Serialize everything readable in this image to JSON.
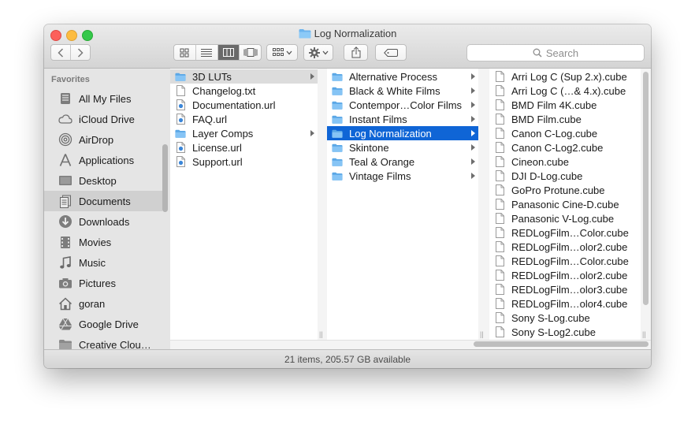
{
  "window": {
    "title": "Log Normalization"
  },
  "toolbar": {
    "search_placeholder": "Search"
  },
  "sidebar": {
    "heading": "Favorites",
    "items": [
      {
        "label": "All My Files",
        "icon": "all-files-icon"
      },
      {
        "label": "iCloud Drive",
        "icon": "cloud-icon"
      },
      {
        "label": "AirDrop",
        "icon": "airdrop-icon"
      },
      {
        "label": "Applications",
        "icon": "applications-icon"
      },
      {
        "label": "Desktop",
        "icon": "desktop-icon"
      },
      {
        "label": "Documents",
        "icon": "documents-icon",
        "selected": true
      },
      {
        "label": "Downloads",
        "icon": "downloads-icon"
      },
      {
        "label": "Movies",
        "icon": "movies-icon"
      },
      {
        "label": "Music",
        "icon": "music-icon"
      },
      {
        "label": "Pictures",
        "icon": "pictures-icon"
      },
      {
        "label": "goran",
        "icon": "home-icon"
      },
      {
        "label": "Google Drive",
        "icon": "google-drive-icon"
      },
      {
        "label": "Creative Clou…",
        "icon": "folder-icon"
      }
    ]
  },
  "columns": {
    "col1": [
      {
        "label": "3D LUTs",
        "type": "folder",
        "arrow": true,
        "state": "path"
      },
      {
        "label": "Changelog.txt",
        "type": "file"
      },
      {
        "label": "Documentation.url",
        "type": "url"
      },
      {
        "label": "FAQ.url",
        "type": "url"
      },
      {
        "label": "Layer Comps",
        "type": "folder",
        "arrow": true
      },
      {
        "label": "License.url",
        "type": "url"
      },
      {
        "label": "Support.url",
        "type": "url"
      }
    ],
    "col2": [
      {
        "label": "Alternative Process",
        "type": "folder",
        "arrow": true
      },
      {
        "label": "Black & White Films",
        "type": "folder",
        "arrow": true
      },
      {
        "label": "Contempor…Color Films",
        "type": "folder",
        "arrow": true
      },
      {
        "label": "Instant Films",
        "type": "folder",
        "arrow": true
      },
      {
        "label": "Log Normalization",
        "type": "folder",
        "arrow": true,
        "state": "selected"
      },
      {
        "label": "Skintone",
        "type": "folder",
        "arrow": true
      },
      {
        "label": "Teal & Orange",
        "type": "folder",
        "arrow": true
      },
      {
        "label": "Vintage Films",
        "type": "folder",
        "arrow": true
      }
    ],
    "col3": [
      {
        "label": "Arri Log C (Sup 2.x).cube",
        "type": "file"
      },
      {
        "label": "Arri Log C (…& 4.x).cube",
        "type": "file"
      },
      {
        "label": "BMD Film 4K.cube",
        "type": "file"
      },
      {
        "label": "BMD Film.cube",
        "type": "file"
      },
      {
        "label": "Canon C-Log.cube",
        "type": "file"
      },
      {
        "label": "Canon C-Log2.cube",
        "type": "file"
      },
      {
        "label": "Cineon.cube",
        "type": "file"
      },
      {
        "label": "DJI D-Log.cube",
        "type": "file"
      },
      {
        "label": "GoPro Protune.cube",
        "type": "file"
      },
      {
        "label": "Panasonic Cine-D.cube",
        "type": "file"
      },
      {
        "label": "Panasonic V-Log.cube",
        "type": "file"
      },
      {
        "label": "REDLogFilm…Color.cube",
        "type": "file"
      },
      {
        "label": "REDLogFilm…olor2.cube",
        "type": "file"
      },
      {
        "label": "REDLogFilm…Color.cube",
        "type": "file"
      },
      {
        "label": "REDLogFilm…olor2.cube",
        "type": "file"
      },
      {
        "label": "REDLogFilm…olor3.cube",
        "type": "file"
      },
      {
        "label": "REDLogFilm…olor4.cube",
        "type": "file"
      },
      {
        "label": "Sony S-Log.cube",
        "type": "file"
      },
      {
        "label": "Sony S-Log2.cube",
        "type": "file"
      }
    ]
  },
  "status": {
    "text": "21 items, 205.57 GB available"
  },
  "colors": {
    "selection": "#0f65d6",
    "folder": "#6cb4ee"
  }
}
